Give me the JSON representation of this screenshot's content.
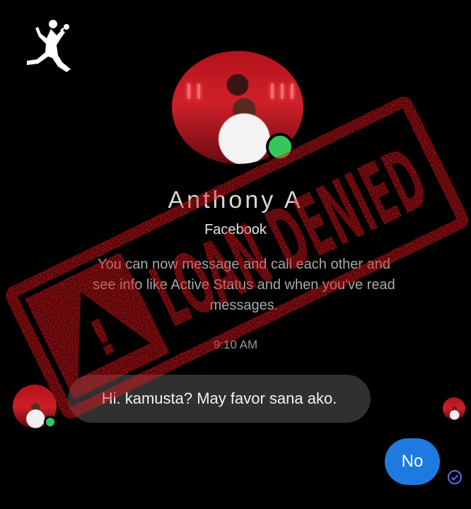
{
  "contact": {
    "name": "Anthony A",
    "subtitle": "Facebook",
    "info": "You can now message and call each other and see info like Active Status and when you've read messages."
  },
  "conversation": {
    "timestamp": "9:10 AM",
    "messages": [
      {
        "direction": "incoming",
        "text": "Hi. kamusta? May favor sana ako."
      },
      {
        "direction": "outgoing",
        "text": "No"
      }
    ]
  },
  "overlay": {
    "stamp_text": "LOAN DENIED",
    "stamp_symbol": "!",
    "stamp_color": "#e3161e"
  },
  "colors": {
    "background": "#000000",
    "incoming_bubble": "#303030",
    "outgoing_bubble": "#1f7ae0",
    "online_indicator": "#35c759"
  },
  "icons": {
    "brand": "jumpman-logo-icon",
    "online": "online-status-icon",
    "delivered": "seen-check-icon"
  }
}
